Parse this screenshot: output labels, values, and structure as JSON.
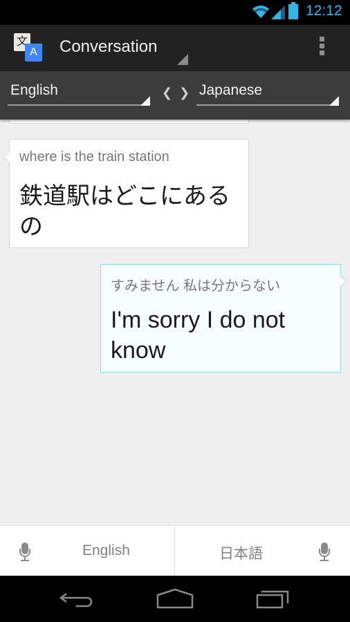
{
  "status_bar": {
    "time": "12:12",
    "icons": [
      "wifi-icon",
      "signal-icon",
      "battery-icon"
    ],
    "accent_color": "#33b5e5"
  },
  "action_bar": {
    "app_icon": "translate-icon",
    "app_icon_glyph_back": "文",
    "app_icon_glyph_front": "A",
    "title": "Conversation",
    "overflow_icon": "overflow-menu-icon"
  },
  "language_bar": {
    "source_language": "English",
    "target_language": "Japanese",
    "swap_glyph": "❮❯"
  },
  "conversation": {
    "messages": [
      {
        "side": "left",
        "source_text": "where is the train station",
        "translated_text": "鉄道駅はどこにあるの"
      },
      {
        "side": "right",
        "source_text": "すみません 私は分からない",
        "translated_text": "I'm sorry I do not know"
      }
    ]
  },
  "input_bar": {
    "left_label": "English",
    "right_label": "日本語",
    "mic_icon": "microphone-icon"
  },
  "nav_bar": {
    "buttons": [
      "back-icon",
      "home-icon",
      "recent-apps-icon"
    ]
  }
}
